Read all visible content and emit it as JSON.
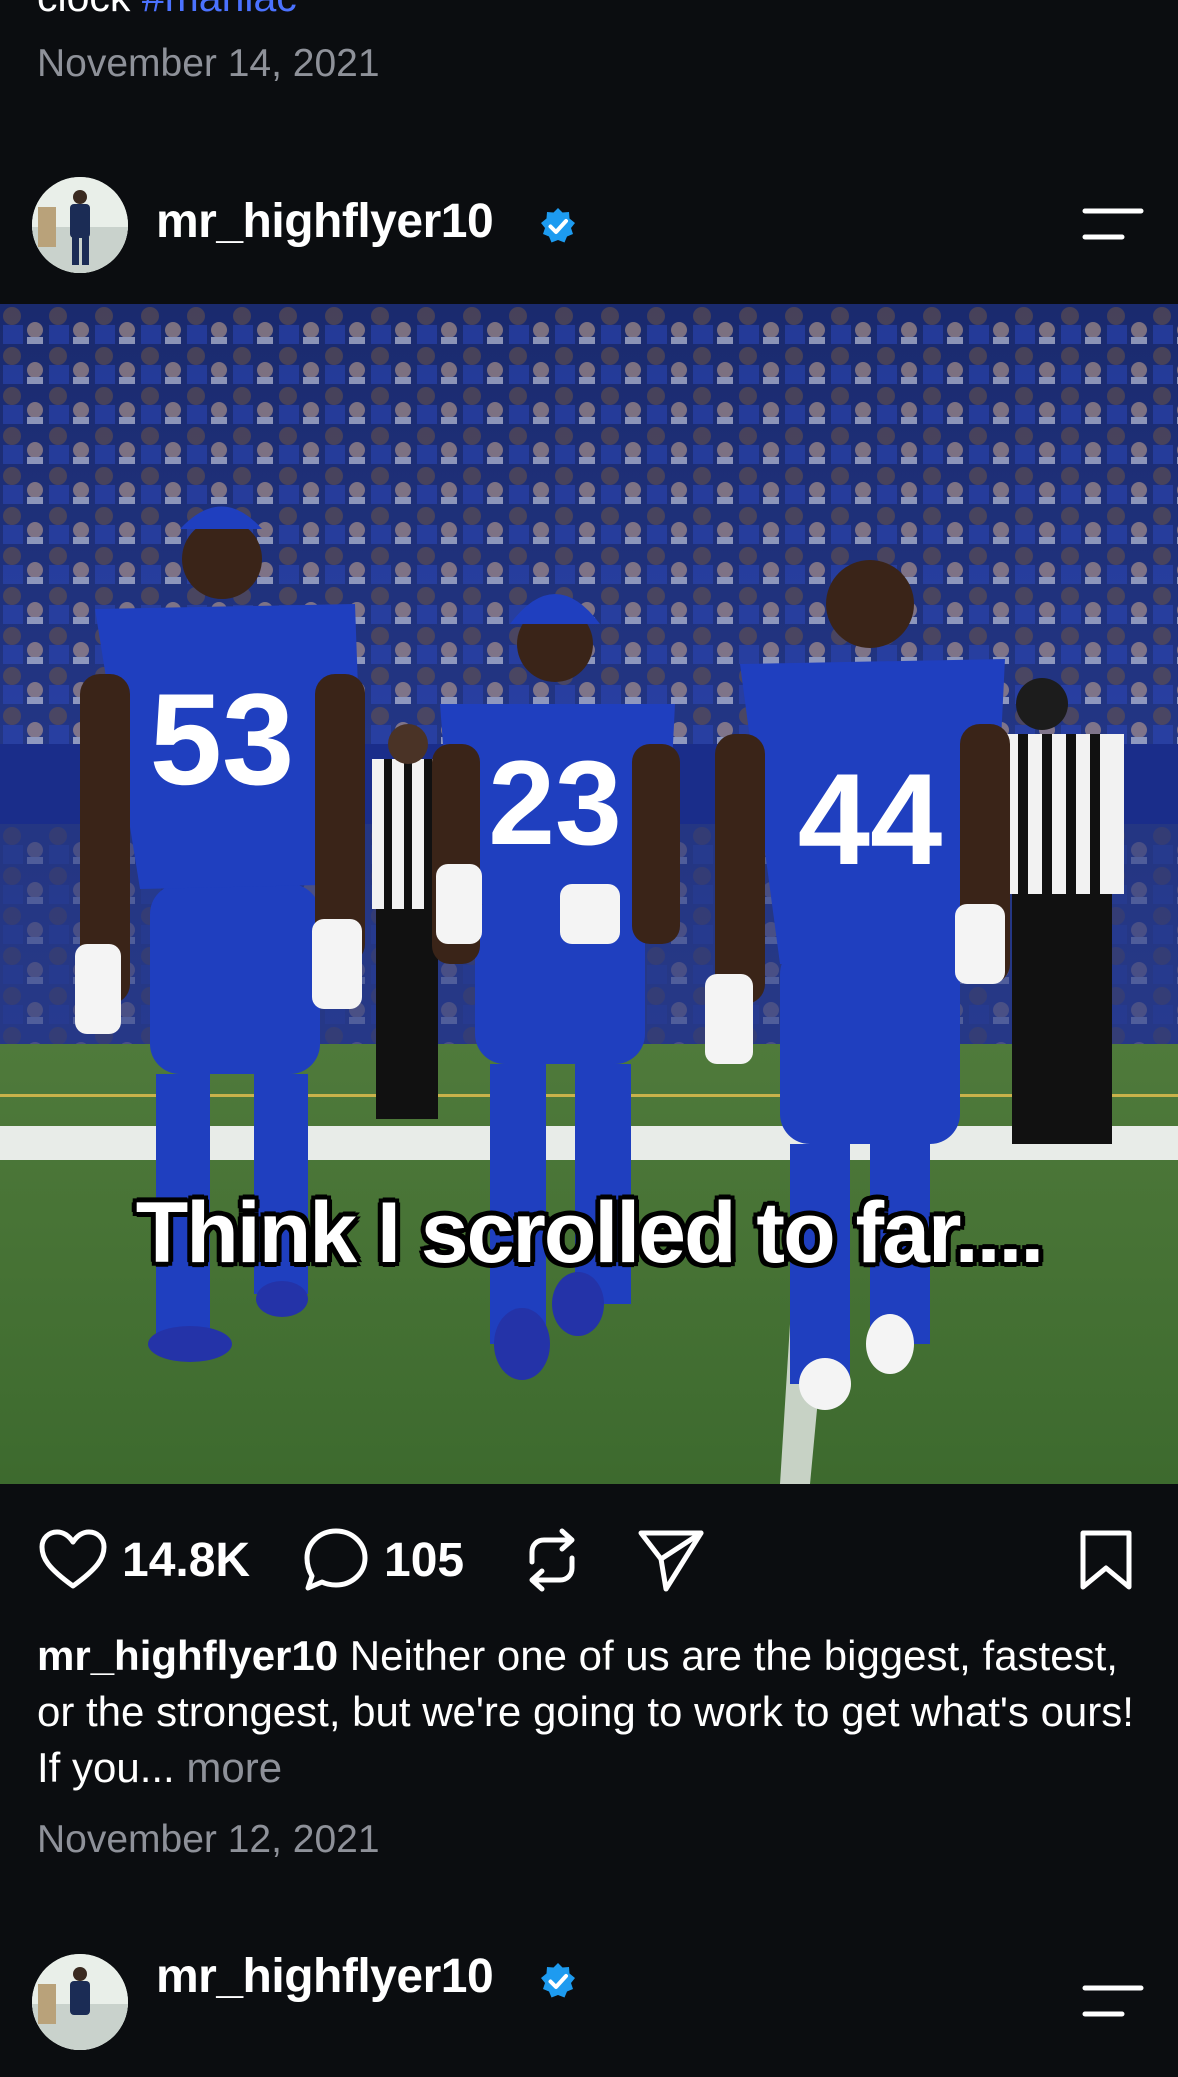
{
  "previous_post": {
    "caption_tail": "clock ",
    "hashtag": "#maniac",
    "date": "November 14, 2021"
  },
  "post": {
    "username": "mr_highflyer10",
    "photo_overlay_text": "Think I scrolled to far....",
    "likes": "14.8K",
    "comments": "105",
    "caption_username": "mr_highflyer10",
    "caption_text": " Neither one of us are the biggest, fastest, or the strongest, but we're going to work to get what's ours! If you... ",
    "more_label": "more",
    "date": "November 12, 2021"
  },
  "next_post": {
    "username": "mr_highflyer10"
  },
  "icons": [
    "verified-icon",
    "menu-icon",
    "heart-icon",
    "comment-icon",
    "repost-icon",
    "share-icon",
    "bookmark-icon"
  ],
  "colors": {
    "background": "#0b0d10",
    "text": "#ffffff",
    "muted": "#8e9199",
    "hashtag": "#4b72ff",
    "verified": "#1d9bf0",
    "jersey_blue": "#1f3fbf"
  }
}
